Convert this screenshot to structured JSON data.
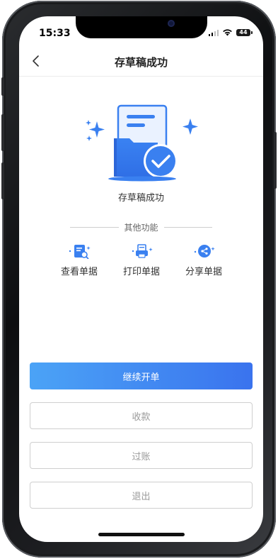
{
  "status_bar": {
    "time": "15:33",
    "battery": "44"
  },
  "nav": {
    "title": "存草稿成功"
  },
  "hero": {
    "message": "存草稿成功"
  },
  "section": {
    "title": "其他功能"
  },
  "functions": [
    {
      "label": "查看单据",
      "icon": "document-search-icon"
    },
    {
      "label": "打印单据",
      "icon": "printer-icon"
    },
    {
      "label": "分享单据",
      "icon": "share-icon"
    }
  ],
  "buttons": {
    "continue": "继续开单",
    "collect": "收款",
    "post": "过账",
    "exit": "退出"
  },
  "colors": {
    "accent": "#3a80f0",
    "accent_light": "#4ba3f6",
    "border": "#cfcfcf"
  }
}
